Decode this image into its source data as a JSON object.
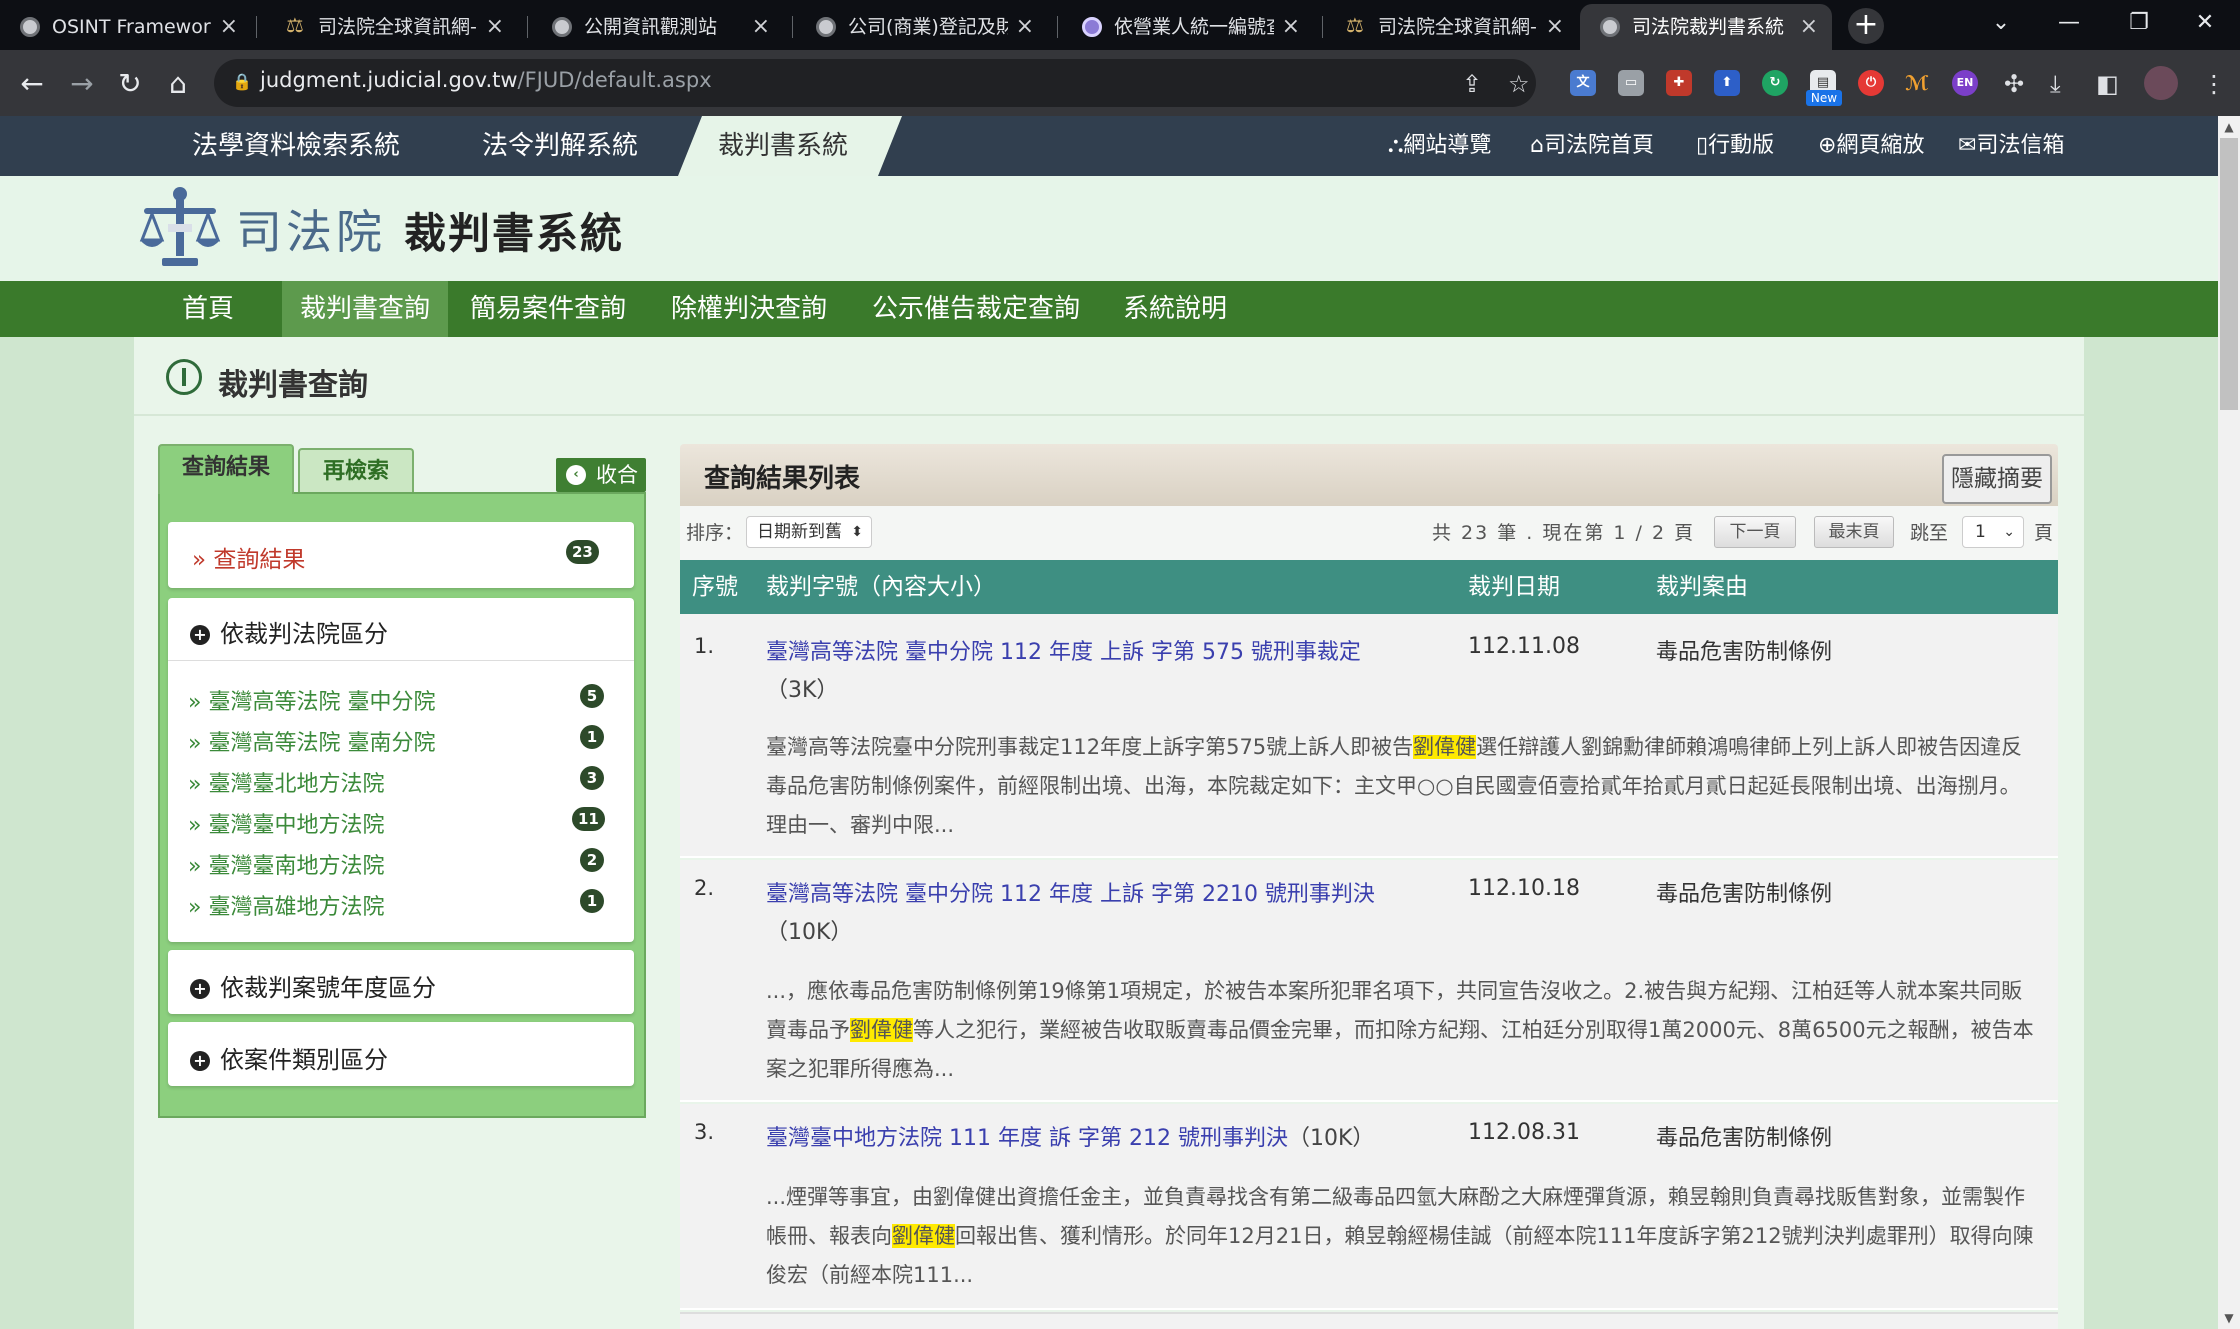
{
  "browser": {
    "tabs": [
      {
        "title": "OSINT Framework",
        "favicon": "globe-icon"
      },
      {
        "title": "司法院全球資訊網-司",
        "favicon": "scale-icon"
      },
      {
        "title": "公開資訊觀測站",
        "favicon": "globe-icon"
      },
      {
        "title": "公司(商業)登記及財",
        "favicon": "globe-icon"
      },
      {
        "title": "依營業人統一編號查",
        "favicon": "shield-icon"
      },
      {
        "title": "司法院全球資訊網-司",
        "favicon": "scale-icon"
      },
      {
        "title": "司法院裁判書系統",
        "favicon": "globe-icon",
        "active": true
      }
    ],
    "url_domain": "judgment.judicial.gov.tw",
    "url_path": "/FJUD/default.aspx",
    "ext_new_badge": "New",
    "ext_en_label": "EN"
  },
  "sysnav": {
    "items": [
      "法學資料檢索系統",
      "法令判解系統",
      "裁判書系統"
    ],
    "active": "裁判書系統"
  },
  "toplinks": [
    "網站導覽",
    "司法院首頁",
    "行動版",
    "網頁縮放",
    "司法信箱"
  ],
  "header": {
    "brand": "司法院",
    "subtitle": "裁判書系統"
  },
  "menu": [
    "首頁",
    "裁判書查詢",
    "簡易案件查詢",
    "除權判決查詢",
    "公示催告裁定查詢",
    "系統說明"
  ],
  "page_title": "裁判書查詢",
  "left": {
    "tab_results": "查詢結果",
    "tab_research": "再檢索",
    "collapse": "收合",
    "results_label": "» 查詢結果",
    "results_count": "23",
    "court_section": "依裁判法院區分",
    "courts": [
      {
        "name": "» 臺灣高等法院 臺中分院",
        "count": "5"
      },
      {
        "name": "» 臺灣高等法院 臺南分院",
        "count": "1"
      },
      {
        "name": "» 臺灣臺北地方法院",
        "count": "3"
      },
      {
        "name": "» 臺灣臺中地方法院",
        "count": "11"
      },
      {
        "name": "» 臺灣臺南地方法院",
        "count": "2"
      },
      {
        "name": "» 臺灣高雄地方法院",
        "count": "1"
      }
    ],
    "year_section": "依裁判案號年度區分",
    "type_section": "依案件類別區分"
  },
  "results": {
    "title": "查詢結果列表",
    "hide_summary": "隱藏摘要",
    "sort_label": "排序：",
    "sort_value": "日期新到舊",
    "page_info": "共 23 筆 . 現在第 1 / 2 頁",
    "next": "下一頁",
    "last": "最末頁",
    "jump_label": "跳至",
    "jump_value": "1",
    "page_unit": "頁",
    "columns": [
      "序號",
      "裁判字號（內容大小）",
      "裁判日期",
      "裁判案由"
    ],
    "rows": [
      {
        "num": "1.",
        "link": "臺灣高等法院 臺中分院 112 年度 上訴 字第 575 號刑事裁定",
        "size": "（3K）",
        "date": "112.11.08",
        "cause": "毒品危害防制條例",
        "sum_pre": "臺灣高等法院臺中分院刑事裁定112年度上訴字第575號上訴人即被告",
        "sum_hl": "劉偉健",
        "sum_post": "選任辯護人劉錦勳律師賴鴻鳴律師上列上訴人即被告因違反毒品危害防制條例案件，前經限制出境、出海，本院裁定如下：主文甲○○自民國壹佰壹拾貳年拾貳月貳日起延長限制出境、出海捌月。理由一、審判中限..."
      },
      {
        "num": "2.",
        "link": "臺灣高等法院 臺中分院 112 年度 上訴 字第 2210 號刑事判決",
        "size": "（10K）",
        "date": "112.10.18",
        "cause": "毒品危害防制條例",
        "sum_pre": "...，應依毒品危害防制條例第19條第1項規定，於被告本案所犯罪名項下，共同宣告沒收之。2.被告與方紀翔、江柏廷等人就本案共同販賣毒品予",
        "sum_hl": "劉偉健",
        "sum_post": "等人之犯行，業經被告收取販賣毒品價金完畢，而扣除方紀翔、江柏廷分別取得1萬2000元、8萬6500元之報酬，被告本案之犯罪所得應為..."
      },
      {
        "num": "3.",
        "link": "臺灣臺中地方法院 111 年度 訴 字第 212 號刑事判決",
        "size": "（10K）",
        "date": "112.08.31",
        "cause": "毒品危害防制條例",
        "sum_pre": "...煙彈等事宜，由劉偉健出資擔任金主，並負責尋找含有第二級毒品四氫大麻酚之大麻煙彈貨源，賴昱翰則負責尋找販售對象，並需製作帳冊、報表向",
        "sum_hl": "劉偉健",
        "sum_post": "回報出售、獲利情形。於同年12月21日，賴昱翰經楊佳誠（前經本院111年度訴字第212號判決判處罪刑）取得向陳俊宏（前經本院111..."
      }
    ]
  }
}
